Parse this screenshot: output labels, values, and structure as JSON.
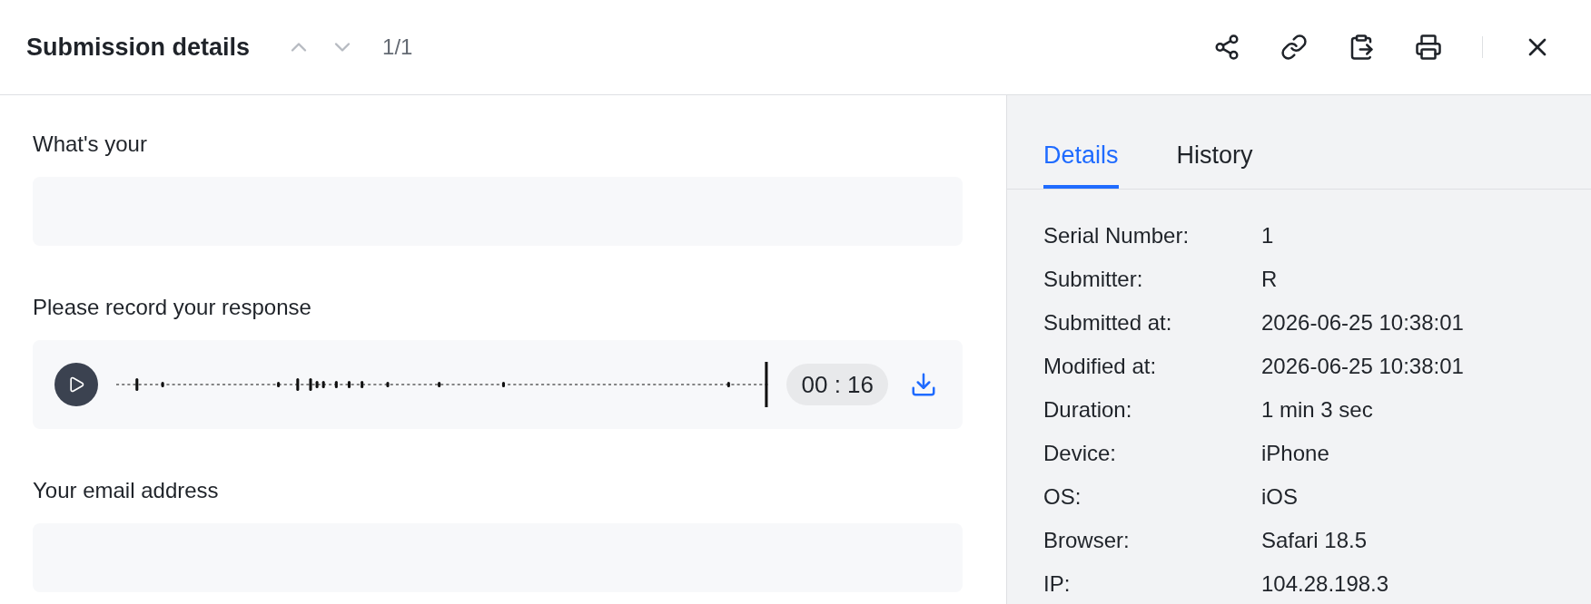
{
  "header": {
    "title": "Submission details",
    "counter": "1/1"
  },
  "questions": [
    {
      "kind": "text",
      "label": "What's your"
    },
    {
      "kind": "audio",
      "label": "Please record your response",
      "time": "00 : 16"
    },
    {
      "kind": "text",
      "label": "Your email address"
    }
  ],
  "tabs": [
    {
      "label": "Details",
      "selected": true
    },
    {
      "label": "History",
      "selected": false
    }
  ],
  "details": [
    {
      "label": "Serial Number:",
      "value": "1"
    },
    {
      "label": "Submitter:",
      "value": "R"
    },
    {
      "label": "Submitted at:",
      "value": "2026-06-25 10:38:01"
    },
    {
      "label": "Modified at:",
      "value": "2026-06-25 10:38:01"
    },
    {
      "label": "Duration:",
      "value": "1 min 3 sec"
    },
    {
      "label": "Device:",
      "value": "iPhone"
    },
    {
      "label": "OS:",
      "value": "iOS"
    },
    {
      "label": "Browser:",
      "value": "Safari 18.5"
    },
    {
      "label": "IP:",
      "value": "104.28.198.3"
    }
  ]
}
